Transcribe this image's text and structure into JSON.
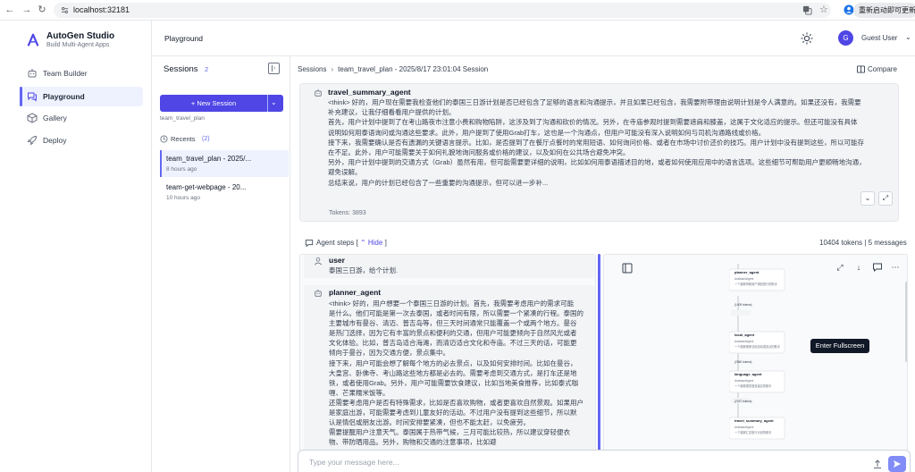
{
  "browser": {
    "url": "localhost:32181",
    "extension_label": "重新启动即可更新"
  },
  "brand": {
    "name": "AutoGen Studio",
    "tagline": "Build Multi-Agent Apps"
  },
  "sidebar": {
    "items": [
      {
        "label": "Team Builder",
        "icon": "robot-icon",
        "active": false
      },
      {
        "label": "Playground",
        "icon": "chat-icon",
        "active": true
      },
      {
        "label": "Gallery",
        "icon": "package-icon",
        "active": false
      },
      {
        "label": "Deploy",
        "icon": "rocket-icon",
        "active": false
      }
    ]
  },
  "header": {
    "title": "Playground",
    "user_initial": "G",
    "user_name": "Guest User"
  },
  "sessions": {
    "title": "Sessions",
    "count": "2",
    "new_button": "New Session",
    "context_label": "team_travel_plan",
    "recents_label": "Recents",
    "recents_count": "(2)",
    "items": [
      {
        "title": "team_travel_plan - 2025/...",
        "time": "8 hours ago",
        "active": true
      },
      {
        "title": "team-get-webpage - 20...",
        "time": "10 hours ago",
        "active": false
      }
    ]
  },
  "breadcrumb": {
    "root": "Sessions",
    "current": "team_travel_plan - 2025/8/17 23:01:04 Session"
  },
  "compare_label": "Compare",
  "summary": {
    "agent": "travel_summary_agent",
    "lines": [
      "<think> 好的，用户现在需要我检查他们的泰国三日游计划是否已经包含了足够的语言和沟通提示，并且如果已经包含，我需要附带理由说明计划是令人满意的。如果还没有，我需要",
      "补充建议，让我仔细看看用户提供的计划。",
      "首先，用户计划中提到了在考山路夜市注意小费和购物陷阱，这涉及到了沟通和砍价的情况。另外，在寺庙参观时提到需要遮肩和膝盖，这属于文化适应的提示。但还可能没有具体",
      "说明如何用泰语询问或沟通这些要求。此外，用户提到了使用Grab打车，这也是一个沟通点，但用户可能没有深入说明如何与司机沟通路线或价格。",
      "接下来，我需要确认是否有遗漏的关键语言提示。比如，是否提到了在餐厅点餐时的常用短语、如何询问价格、或者在市场中讨价还价的技巧。用户计划中没有提到这些，所以可能存",
      "在不足。此外，用户可能需要关于如何礼貌地询问服务或价格的建议，以及如何在公共场合避免冲突。",
      "另外，用户计划中提到的交通方式（Grab）虽然有用，但可能需要更详细的说明，比如如何用泰语描述目的地，或者如何使用应用中的语言选项。这些细节可帮助用户更顺畅地沟通，",
      "避免误解。",
      "总结来说，用户的计划已经包含了一些重要的沟通提示，但可以进一步补..."
    ],
    "tokens": "Tokens: 3893"
  },
  "agent_steps": {
    "label": "Agent steps [",
    "hide": "Hide",
    "close": "]",
    "meta": "10404 tokens | 5 messages",
    "messages": [
      {
        "agent": "user",
        "lines": [
          "泰国三日游，给个计划."
        ]
      },
      {
        "agent": "planner_agent",
        "lines": [
          "<think> 好的，用户想要一个泰国三日游的计划。首先，我需要考虑用户的需求可能",
          "是什么。他们可能是第一次去泰国，或者时间有限，所以需要一个紧凑的行程。泰国的",
          "主要城市有曼谷、清迈、普吉岛等，但三天时间通常只能覆盖一个或两个地方。曼谷",
          "是热门选择，因为它有丰富的景点和便利的交通，但用户可能更倾向于自然风光或者",
          "文化体验。比如，普吉岛适合海滩，而清迈适合文化和寺庙。不过三天的话，可能更",
          "倾向于曼谷，因为交通方便，景点集中。",
          "接下来，用户可能会想了解每个地方的必去景点，以及如何安排时间。比如在曼谷，",
          "大皇宫、卧佛寺、考山路这些地方都是必去的。需要考虑到交通方式，是打车还是地",
          "铁，或者使用Grab。另外，用户可能需要饮食建议，比如当地美食推荐，比如泰式咖",
          "喱、芒果糯米饭等。",
          "还需要考虑用户是否有特殊需求，比如是否喜欢购物，或者更喜欢自然景观。如果用户",
          "是家庭出游，可能需要考虑到儿童友好的活动。不过用户没有提到这些细节，所以默",
          "认是情侣或朋友出游。时间安排要紧凑，但也不能太赶，以免疲劳。",
          "需要提醒用户注意天气。泰国属于热带气候，三月可能比较热，所以建议穿轻便衣",
          "物、带防晒用品。另外，购物和交通的注意事项，比如避"
        ]
      }
    ]
  },
  "flow": {
    "tooltip": "Enter Fullscreen",
    "nodes": [
      {
        "title": "planner_agent",
        "sub1": "AssistantAgent",
        "sub2": "一个能够帮助用户规划旅行的助手",
        "tokens": "(1409 tokens)"
      },
      {
        "title": "local_agent",
        "sub1": "AssistantAgent",
        "sub2": "一个能够推荐当地活动或景点的助手",
        "tokens": "(2560 tokens)"
      },
      {
        "title": "language_agent",
        "sub1": "AssistantAgent",
        "sub2": "一个能够提供语言建议的助手",
        "tokens": "(2037 tokens)"
      },
      {
        "title": "travel_summary_agent",
        "sub1": "AssistantAgent",
        "sub2": "一个能够汇总旅行计划的助手",
        "tokens": ""
      }
    ]
  },
  "chat": {
    "placeholder": "Type your message here..."
  },
  "colors": {
    "accent": "#4f46e5",
    "accent_light": "#eef2ff",
    "text": "#1f2937",
    "muted": "#6b7280"
  }
}
